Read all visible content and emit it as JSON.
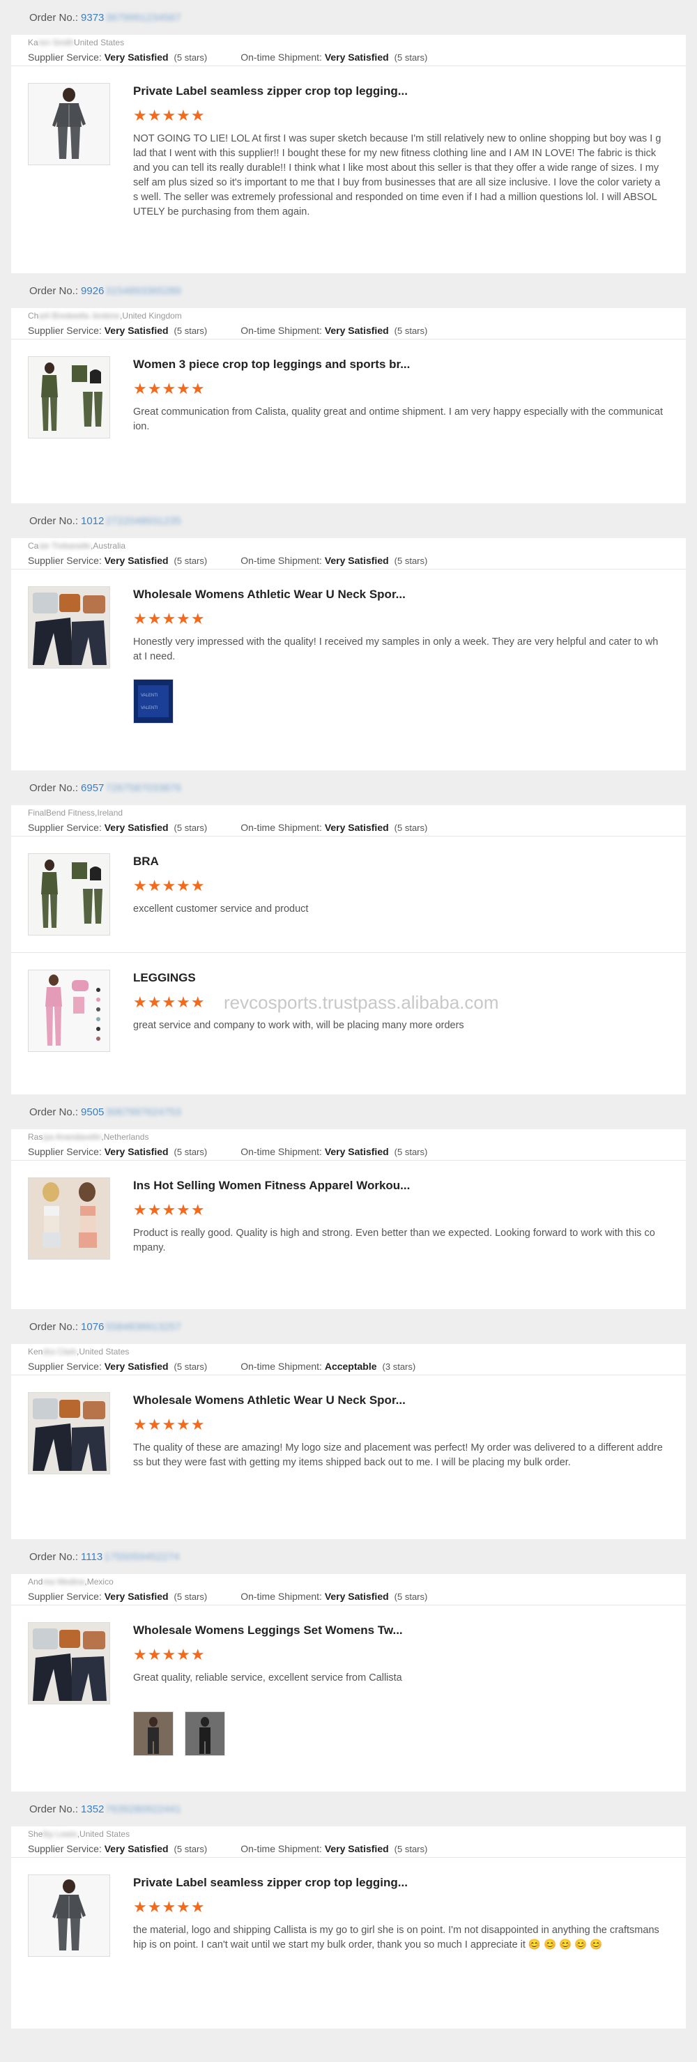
{
  "labels": {
    "order_no": "Order No.:",
    "supplier_service": "Supplier Service:",
    "ontime_shipment": "On-time Shipment:"
  },
  "stars_glyph": "★★★★★",
  "watermark": "revcosports.trustpass.alibaba.com",
  "accent_color": "#f26b1d",
  "link_color": "#3a7fc1",
  "orders": [
    {
      "order_prefix": "9373",
      "order_rest": "3679991234567",
      "buyer_prefix": "Ka",
      "buyer_hidden": "ren Smith",
      "buyer_suffix": "United States",
      "supplier_rating": "Very Satisfied",
      "supplier_stars": "(5 stars)",
      "shipment_rating": "Very Satisfied",
      "shipment_stars": "(5 stars)",
      "products": [
        {
          "title": "Private Label seamless zipper crop top legging...",
          "review": "NOT GOING TO LIE! LOL At first I was super sketch because I'm still relatively new to online shopping but boy was I glad that I went with this supplier!! I bought these for my new fitness clothing line and I AM IN LOVE! The fabric is thick and you can tell its really durable!! I think what I like most about this seller is that they offer a wide range of sizes. I myself am plus sized so it's important to me that I buy from businesses that are all size inclusive. I love the color variety as well. The seller was extremely professional and responded on time even if I had a million questions lol. I will ABSOLUTELY be purchasing from them again.",
          "image": "zip-set"
        }
      ]
    },
    {
      "order_prefix": "9926",
      "order_rest": "3154893365289",
      "buyer_prefix": "Ch",
      "buyer_hidden": "arli Bredwella Jenkine",
      "buyer_suffix": ",United Kingdom",
      "supplier_rating": "Very Satisfied",
      "supplier_stars": "(5 stars)",
      "shipment_rating": "Very Satisfied",
      "shipment_stars": "(5 stars)",
      "products": [
        {
          "title": "Women 3 piece crop top leggings and sports br...",
          "review": "Great communication from Calista, quality great and ontime shipment. I am very happy especially with the communication.",
          "image": "three-piece"
        }
      ]
    },
    {
      "order_prefix": "1012",
      "order_rest": "2722048931235",
      "buyer_prefix": "Ca",
      "buyer_hidden": "sie Trebanelle",
      "buyer_suffix": ",Australia",
      "supplier_rating": "Very Satisfied",
      "supplier_stars": "(5 stars)",
      "shipment_rating": "Very Satisfied",
      "shipment_stars": "(5 stars)",
      "products": [
        {
          "title": "Wholesale Womens Athletic Wear U Neck Spor...",
          "review": "Honestly very impressed with the quality! I received my samples in only a week. They are very helpful and cater to what I need.",
          "image": "athletic-set",
          "attachments": [
            "blue-fabric"
          ]
        }
      ]
    },
    {
      "order_prefix": "6957",
      "order_rest": "7267587033876",
      "buyer_prefix": "FinalBend Fitness,Ireland",
      "buyer_hidden": "",
      "buyer_suffix": "",
      "supplier_rating": "Very Satisfied",
      "supplier_stars": "(5 stars)",
      "shipment_rating": "Very Satisfied",
      "shipment_stars": "(5 stars)",
      "products": [
        {
          "title": "BRA",
          "review": "excellent customer service and product",
          "image": "three-piece"
        },
        {
          "title": "LEGGINGS",
          "review": "great service and company to work with, will be placing many more orders",
          "image": "pink-set"
        }
      ]
    },
    {
      "order_prefix": "9505",
      "order_rest": "3067997624753",
      "buyer_prefix": "Ras",
      "buyer_hidden": "iya Anandavelin",
      "buyer_suffix": ",Netherlands",
      "supplier_rating": "Very Satisfied",
      "supplier_stars": "(5 stars)",
      "shipment_rating": "Very Satisfied",
      "shipment_stars": "(5 stars)",
      "products": [
        {
          "title": "Ins Hot Selling Women Fitness Apparel Workou...",
          "review": "Product is really good. Quality is high and strong. Even better than we expected. Looking forward to work with this company.",
          "image": "two-women"
        }
      ]
    },
    {
      "order_prefix": "1076",
      "order_rest": "5584836913257",
      "buyer_prefix": "Ken",
      "buyer_hidden": "dra Clark",
      "buyer_suffix": ",United States",
      "supplier_rating": "Very Satisfied",
      "supplier_stars": "(5 stars)",
      "shipment_rating": "Acceptable",
      "shipment_stars": "(3 stars)",
      "products": [
        {
          "title": "Wholesale Womens Athletic Wear U Neck Spor...",
          "review": "The quality of these are amazing! My logo size and placement was perfect! My order was delivered to a different address but they were fast with getting my items shipped back out to me. I will be placing my bulk order.",
          "image": "athletic-set"
        }
      ]
    },
    {
      "order_prefix": "1113",
      "order_rest": "1755059452274",
      "buyer_prefix": "And",
      "buyer_hidden": "rea Medina",
      "buyer_suffix": ",Mexico",
      "supplier_rating": "Very Satisfied",
      "supplier_stars": "(5 stars)",
      "shipment_rating": "Very Satisfied",
      "shipment_stars": "(5 stars)",
      "products": [
        {
          "title": "Wholesale Womens Leggings Set Womens Tw...",
          "review": "Great quality, reliable service, excellent service from Callista",
          "image": "athletic-set",
          "attachments": [
            "photo-a",
            "photo-b"
          ]
        }
      ]
    },
    {
      "order_prefix": "1352",
      "order_rest": "7639280922441",
      "buyer_prefix": "She",
      "buyer_hidden": "lby Lewis",
      "buyer_suffix": ",United States",
      "supplier_rating": "Very Satisfied",
      "supplier_stars": "(5 stars)",
      "shipment_rating": "Very Satisfied",
      "shipment_stars": "(5 stars)",
      "products": [
        {
          "title": "Private Label seamless zipper crop top legging...",
          "review": "the material, logo and shipping Callista is my go to girl she is on point. I'm not disappointed in anything the craftsmanship is on point. I can't wait until we start my bulk order, thank you so much I appreciate it 😊 😊 😊 😊 😊",
          "image": "zip-set-2"
        }
      ]
    }
  ]
}
